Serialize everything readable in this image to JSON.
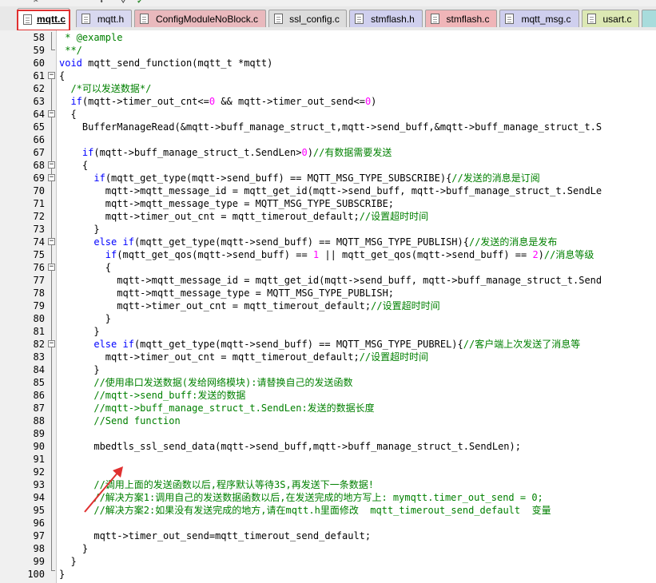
{
  "tabs": [
    {
      "label": "mqtt.c",
      "active": true,
      "color": "#ffffff"
    },
    {
      "label": "mqtt.h",
      "active": false,
      "color": "#d8d8f0"
    },
    {
      "label": "ConfigModuleNoBlock.c",
      "active": false,
      "color": "#e9b9bd"
    },
    {
      "label": "ssl_config.c",
      "active": false,
      "color": "#dcdcdc"
    },
    {
      "label": "stmflash.h",
      "active": false,
      "color": "#cfcfee"
    },
    {
      "label": "stmflash.c",
      "active": false,
      "color": "#efb5b8"
    },
    {
      "label": "mqtt_msg.c",
      "active": false,
      "color": "#cfcfee"
    },
    {
      "label": "usart.c",
      "active": false,
      "color": "#dce8b4"
    }
  ],
  "code_lines": [
    {
      "num": "58",
      "text": " * @example"
    },
    {
      "num": "59",
      "text": " **/"
    },
    {
      "num": "60",
      "text": "void mqtt_send_function(mqtt_t *mqtt)"
    },
    {
      "num": "61",
      "text": "{"
    },
    {
      "num": "62",
      "text": "  /*可以发送数据*/"
    },
    {
      "num": "63",
      "text": "  if(mqtt->timer_out_cnt<=0 && mqtt->timer_out_send<=0)"
    },
    {
      "num": "64",
      "text": "  {"
    },
    {
      "num": "65",
      "text": "    BufferManageRead(&mqtt->buff_manage_struct_t,mqtt->send_buff,&mqtt->buff_manage_struct_t.S"
    },
    {
      "num": "66",
      "text": ""
    },
    {
      "num": "67",
      "text": "    if(mqtt->buff_manage_struct_t.SendLen>0)//有数据需要发送"
    },
    {
      "num": "68",
      "text": "    {"
    },
    {
      "num": "69",
      "text": "      if(mqtt_get_type(mqtt->send_buff) == MQTT_MSG_TYPE_SUBSCRIBE){//发送的消息是订阅"
    },
    {
      "num": "70",
      "text": "        mqtt->mqtt_message_id = mqtt_get_id(mqtt->send_buff, mqtt->buff_manage_struct_t.SendLe"
    },
    {
      "num": "71",
      "text": "        mqtt->mqtt_message_type = MQTT_MSG_TYPE_SUBSCRIBE;"
    },
    {
      "num": "72",
      "text": "        mqtt->timer_out_cnt = mqtt_timerout_default;//设置超时时间"
    },
    {
      "num": "73",
      "text": "      }"
    },
    {
      "num": "74",
      "text": "      else if(mqtt_get_type(mqtt->send_buff) == MQTT_MSG_TYPE_PUBLISH){//发送的消息是发布"
    },
    {
      "num": "75",
      "text": "        if(mqtt_get_qos(mqtt->send_buff) == 1 || mqtt_get_qos(mqtt->send_buff) == 2)//消息等级"
    },
    {
      "num": "76",
      "text": "        {"
    },
    {
      "num": "77",
      "text": "          mqtt->mqtt_message_id = mqtt_get_id(mqtt->send_buff, mqtt->buff_manage_struct_t.Send"
    },
    {
      "num": "78",
      "text": "          mqtt->mqtt_message_type = MQTT_MSG_TYPE_PUBLISH;"
    },
    {
      "num": "79",
      "text": "          mqtt->timer_out_cnt = mqtt_timerout_default;//设置超时时间"
    },
    {
      "num": "80",
      "text": "        }"
    },
    {
      "num": "81",
      "text": "      }"
    },
    {
      "num": "82",
      "text": "      else if(mqtt_get_type(mqtt->send_buff) == MQTT_MSG_TYPE_PUBREL){//客户端上次发送了消息等"
    },
    {
      "num": "83",
      "text": "        mqtt->timer_out_cnt = mqtt_timerout_default;//设置超时时间"
    },
    {
      "num": "84",
      "text": "      }"
    },
    {
      "num": "85",
      "text": "      //使用串口发送数据(发给网络模块):请替换自己的发送函数"
    },
    {
      "num": "86",
      "text": "      //mqtt->send_buff:发送的数据"
    },
    {
      "num": "87",
      "text": "      //mqtt->buff_manage_struct_t.SendLen:发送的数据长度"
    },
    {
      "num": "88",
      "text": "      //Send function"
    },
    {
      "num": "89",
      "text": ""
    },
    {
      "num": "90",
      "text": "      mbedtls_ssl_send_data(mqtt->send_buff,mqtt->buff_manage_struct_t.SendLen);"
    },
    {
      "num": "91",
      "text": ""
    },
    {
      "num": "92",
      "text": ""
    },
    {
      "num": "93",
      "text": "      //调用上面的发送函数以后,程序默认等待3S,再发送下一条数据!"
    },
    {
      "num": "94",
      "text": "      //解决方案1:调用自己的发送数据函数以后,在发送完成的地方写上: mymqtt.timer_out_send = 0;"
    },
    {
      "num": "95",
      "text": "      //解决方案2:如果没有发送完成的地方,请在mqtt.h里面修改  mqtt_timerout_send_default  变量"
    },
    {
      "num": "96",
      "text": ""
    },
    {
      "num": "97",
      "text": "      mqtt->timer_out_send=mqtt_timerout_send_default;"
    },
    {
      "num": "98",
      "text": "    }"
    },
    {
      "num": "99",
      "text": "  }"
    },
    {
      "num": "100",
      "text": "}"
    }
  ],
  "colors": {
    "comment": "#008000",
    "keyword": "#0000ff",
    "number": "#ff00ff",
    "highlight_box": "#e03030",
    "arrow": "#e03030"
  },
  "icons": [
    "cut-icon",
    "download-icon",
    "filter-icon",
    "check-icon"
  ]
}
